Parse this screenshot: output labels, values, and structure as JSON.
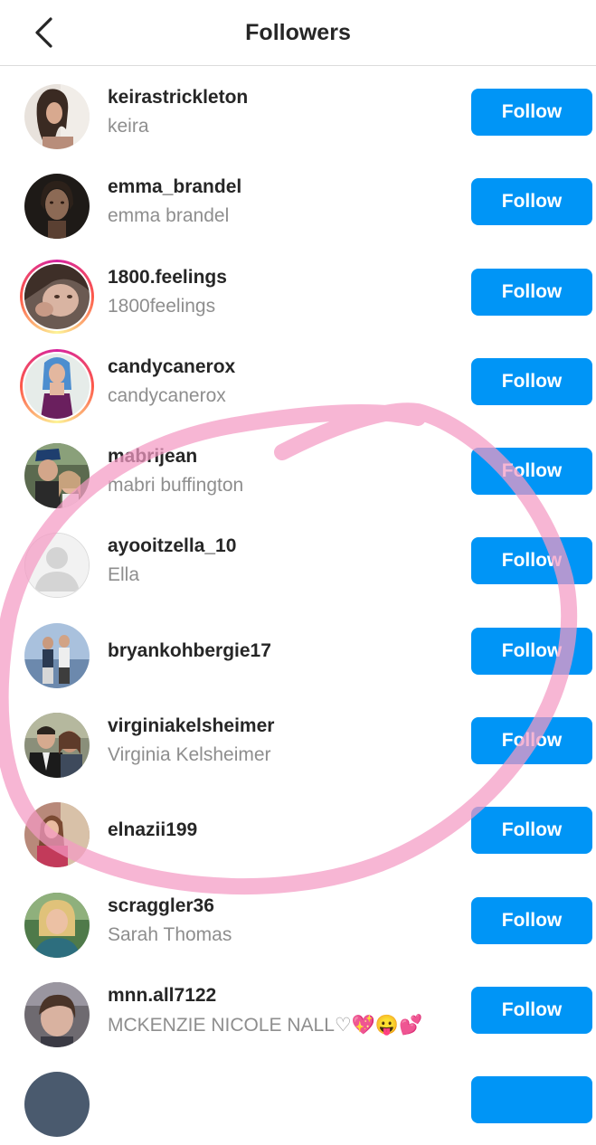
{
  "header": {
    "title": "Followers",
    "back_icon": "chevron-left-icon"
  },
  "colors": {
    "follow_button": "#0095f6",
    "username": "#262626",
    "fullname": "#8e8e8e",
    "annotation": "#f7a8cc"
  },
  "followers": [
    {
      "username": "keirastrickleton",
      "fullname": "keira",
      "story_ring": false,
      "follow_label": "Follow",
      "avatar": "photo"
    },
    {
      "username": "emma_brandel",
      "fullname": "emma brandel",
      "story_ring": false,
      "follow_label": "Follow",
      "avatar": "photo"
    },
    {
      "username": "1800.feelings",
      "fullname": "1800feelings",
      "story_ring": true,
      "follow_label": "Follow",
      "avatar": "photo"
    },
    {
      "username": "candycanerox",
      "fullname": "candycanerox",
      "story_ring": true,
      "follow_label": "Follow",
      "avatar": "photo"
    },
    {
      "username": "mabrijean",
      "fullname": "mabri buffington",
      "story_ring": false,
      "follow_label": "Follow",
      "avatar": "photo"
    },
    {
      "username": "ayooitzella_10",
      "fullname": "Ella",
      "story_ring": false,
      "follow_label": "Follow",
      "avatar": "default-user-icon"
    },
    {
      "username": "bryankohbergie17",
      "fullname": "",
      "story_ring": false,
      "follow_label": "Follow",
      "avatar": "photo"
    },
    {
      "username": "virginiakelsheimer",
      "fullname": "Virginia Kelsheimer",
      "story_ring": false,
      "follow_label": "Follow",
      "avatar": "photo"
    },
    {
      "username": "elnazii199",
      "fullname": "",
      "story_ring": false,
      "follow_label": "Follow",
      "avatar": "photo"
    },
    {
      "username": "scraggler36",
      "fullname": "Sarah Thomas",
      "story_ring": false,
      "follow_label": "Follow",
      "avatar": "photo"
    },
    {
      "username": "mnn.all7122",
      "fullname": "MCKENZIE NICOLE NALL♡💖😛💕",
      "story_ring": false,
      "follow_label": "Follow",
      "avatar": "photo"
    }
  ]
}
